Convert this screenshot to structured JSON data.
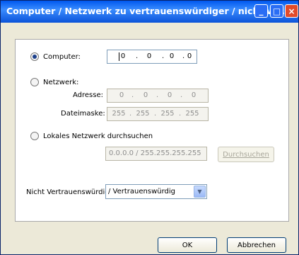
{
  "window": {
    "title": "Computer / Netzwerk zu vertrauenswürdiger / nicht ve..."
  },
  "titlebar_buttons": {
    "min": "_",
    "max": "□",
    "close": "×"
  },
  "computer": {
    "label": "Computer:",
    "octets": [
      "0",
      "0",
      "0",
      "0"
    ],
    "selected": true
  },
  "network": {
    "label": "Netzwerk:",
    "address_label": "Adresse:",
    "address_octets": [
      "0",
      "0",
      "0",
      "0"
    ],
    "mask_label": "Dateimaske:",
    "mask_octets": [
      "255",
      "255",
      "255",
      "255"
    ]
  },
  "local": {
    "label": "Lokales Netzwerk durchsuchen",
    "range_value": "0.0.0.0 / 255.255.255.255",
    "browse_label": "Durchsuchen"
  },
  "trust": {
    "prefix": "Nicht Vertrauenswürdig",
    "selected": "/ Vertrauenswürdig"
  },
  "dialog": {
    "ok": "OK",
    "cancel": "Abbrechen"
  },
  "colors": {
    "titlebar": "#0058ee",
    "close_button": "#e24b2a",
    "panel": "#ffffff"
  }
}
